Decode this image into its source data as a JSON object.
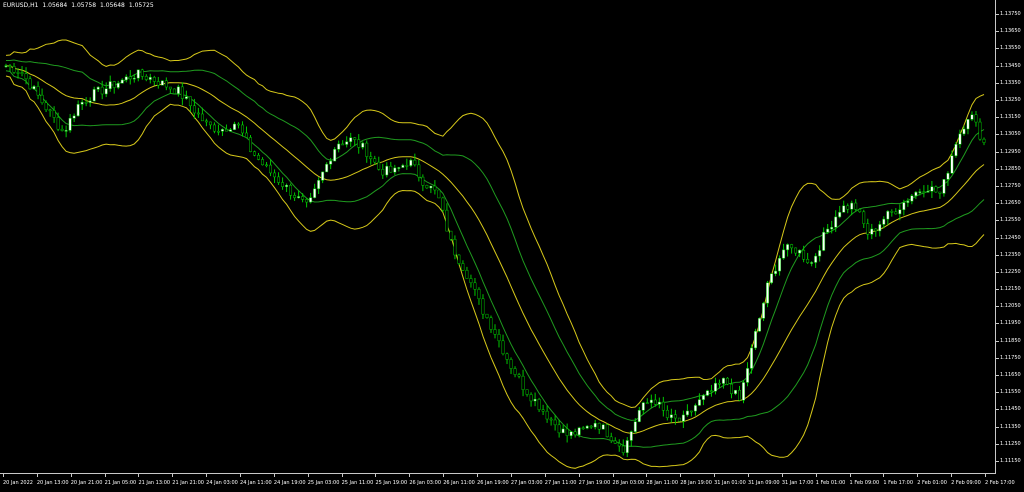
{
  "header": {
    "symbol": "EURUSD,H1",
    "open": "1.05684",
    "high": "1.05758",
    "low": "1.05648",
    "close": "1.05725"
  },
  "price_axis": {
    "labels": [
      "1.13750",
      "1.13650",
      "1.13550",
      "1.13450",
      "1.13350",
      "1.13250",
      "1.13150",
      "1.13050",
      "1.12950",
      "1.12850",
      "1.12750",
      "1.12650",
      "1.12550",
      "1.12450",
      "1.12350",
      "1.12250",
      "1.12150",
      "1.12050",
      "1.11950",
      "1.11850",
      "1.11750",
      "1.11650",
      "1.11550",
      "1.11450",
      "1.11350",
      "1.11250",
      "1.11150"
    ]
  },
  "time_axis": {
    "labels": [
      "20 Jan 2022",
      "20 Jan 13:00",
      "20 Jan 21:00",
      "21 Jan 05:00",
      "21 Jan 13:00",
      "21 Jan 21:00",
      "24 Jan 03:00",
      "24 Jan 11:00",
      "24 Jan 19:00",
      "25 Jan 03:00",
      "25 Jan 11:00",
      "25 Jan 19:00",
      "26 Jan 03:00",
      "26 Jan 11:00",
      "26 Jan 19:00",
      "27 Jan 03:00",
      "27 Jan 11:00",
      "27 Jan 19:00",
      "28 Jan 03:00",
      "28 Jan 11:00",
      "28 Jan 19:00",
      "31 Jan 01:00",
      "31 Jan 09:00",
      "31 Jan 17:00",
      "1 Feb 01:00",
      "1 Feb 09:00",
      "1 Feb 17:00",
      "2 Feb 01:00",
      "2 Feb 09:00",
      "2 Feb 17:00"
    ]
  },
  "colors": {
    "background": "#000000",
    "candle_bull": "#ffffff",
    "candle_bear": "#00c800",
    "outer_band": "#d6c81a",
    "inner_band": "#1f9a1f",
    "axis": "#c8c8c8"
  },
  "chart_data": {
    "type": "candlestick",
    "y_range": [
      1.1115,
      1.1375
    ],
    "close_path": [
      1.1345,
      1.1342,
      1.133,
      1.1318,
      1.1306,
      1.1322,
      1.1328,
      1.1332,
      1.1336,
      1.134,
      1.1338,
      1.1334,
      1.133,
      1.132,
      1.131,
      1.1308,
      1.1312,
      1.1296,
      1.1286,
      1.1278,
      1.127,
      1.1262,
      1.1282,
      1.13,
      1.1302,
      1.1296,
      1.1284,
      1.1283,
      1.129,
      1.1278,
      1.127,
      1.124,
      1.1225,
      1.1205,
      1.119,
      1.1172,
      1.1158,
      1.1148,
      1.1138,
      1.113,
      1.1132,
      1.1138,
      1.113,
      1.1122,
      1.1144,
      1.1152,
      1.114,
      1.1138,
      1.1148,
      1.1155,
      1.1162,
      1.115,
      1.1185,
      1.1218,
      1.1238,
      1.1238,
      1.123,
      1.1248,
      1.1262,
      1.1264,
      1.1246,
      1.1256,
      1.1262,
      1.127,
      1.1275,
      1.127,
      1.13,
      1.1318,
      1.13
    ]
  }
}
